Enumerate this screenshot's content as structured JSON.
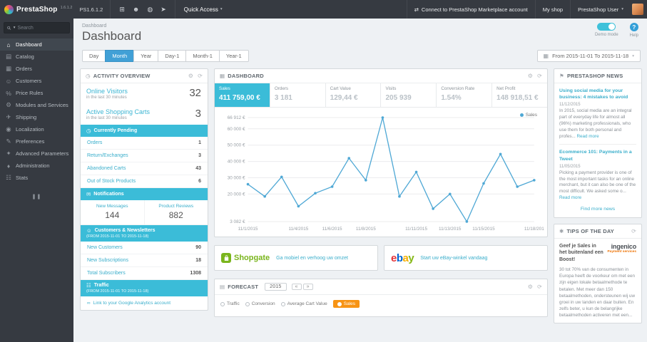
{
  "colors": {
    "topbar_bg": "#363a41",
    "accent_cyan": "#3bbcd8",
    "link_cyan": "#3aaecb",
    "active_button_blue": "#41a0d6",
    "forecast_sales_orange": "#f79415",
    "chart_line_blue": "#4fa8d5",
    "shopgate_green": "#7ab51d"
  },
  "glyphs": {
    "caret_down": "▾",
    "gear": "⚙",
    "refresh": "⟳",
    "calendar": "▦",
    "clock": "◷",
    "envelope": "✉",
    "people": "☺",
    "chart": "☷",
    "flag": "⚑",
    "bulb": "✱",
    "grid": "▦",
    "panel_lines": "▤",
    "link": "∞",
    "arrow_left": "«",
    "arrow_right": "»",
    "pause": "❚❚",
    "cart": "⊞",
    "profile": "☻",
    "lifering": "◍",
    "rocket": "➤",
    "plug": "⇄"
  },
  "topbar": {
    "brand": "PrestaShop",
    "brand_version": "1.6.1.2",
    "shop_version": "PS1.6.1.2",
    "quick_access": "Quick Access",
    "marketplace_link": "Connect to PrestaShop Marketplace account",
    "my_shop": "My shop",
    "user": "PrestaShop User"
  },
  "sidebar": {
    "search_placeholder": "Search",
    "items": [
      {
        "label": "Dashboard",
        "icon": "⌂"
      },
      {
        "label": "Catalog",
        "icon": "▤"
      },
      {
        "label": "Orders",
        "icon": "▦"
      },
      {
        "label": "Customers",
        "icon": "☺"
      },
      {
        "label": "Price Rules",
        "icon": "%"
      },
      {
        "label": "Modules and Services",
        "icon": "⚙"
      },
      {
        "label": "Shipping",
        "icon": "✈"
      },
      {
        "label": "Localization",
        "icon": "◉"
      },
      {
        "label": "Preferences",
        "icon": "✎"
      },
      {
        "label": "Advanced Parameters",
        "icon": "✦"
      },
      {
        "label": "Administration",
        "icon": "♦"
      },
      {
        "label": "Stats",
        "icon": "☷"
      }
    ]
  },
  "header": {
    "breadcrumb": "Dashboard",
    "title": "Dashboard",
    "demo_mode_label": "Demo mode",
    "help_label": "Help",
    "help_q": "?"
  },
  "toolbar": {
    "buttons": [
      "Day",
      "Month",
      "Year",
      "Day-1",
      "Month-1",
      "Year-1"
    ],
    "active": "Month",
    "date_range": "From 2015-11-01 To 2015-11-18"
  },
  "activity": {
    "title": "ACTIVITY OVERVIEW",
    "stats": [
      {
        "label": "Online Visitors",
        "value": "32",
        "sub": "in the last 30 minutes"
      },
      {
        "label": "Active Shopping Carts",
        "value": "3",
        "sub": "in the last 30 minutes"
      }
    ],
    "pending": {
      "title": "Currently Pending",
      "rows": [
        {
          "label": "Orders",
          "value": "1"
        },
        {
          "label": "Return/Exchanges",
          "value": "3"
        },
        {
          "label": "Abandoned Carts",
          "value": "43"
        },
        {
          "label": "Out of Stock Products",
          "value": "6"
        }
      ]
    },
    "notifications": {
      "title": "Notifications",
      "cells": [
        {
          "label": "New Messages",
          "value": "144"
        },
        {
          "label": "Product Reviews",
          "value": "882"
        }
      ]
    },
    "customers": {
      "title": "Customers & Newsletters",
      "subtitle": "(FROM 2015-11-01 TO 2015-11-18)",
      "rows": [
        {
          "label": "New Customers",
          "value": "90"
        },
        {
          "label": "New Subscriptions",
          "value": "18"
        },
        {
          "label": "Total Subscribers",
          "value": "1308"
        }
      ]
    },
    "traffic": {
      "title": "Traffic",
      "subtitle": "(FROM 2015-11-01 TO 2015-11-18)",
      "link": "Link to your Google Analytics account"
    }
  },
  "dashboard": {
    "title": "DASHBOARD",
    "kpis": [
      {
        "label": "Sales",
        "value": "411 759,00 €"
      },
      {
        "label": "Orders",
        "value": "3 181"
      },
      {
        "label": "Cart Value",
        "value": "129,44 €"
      },
      {
        "label": "Visits",
        "value": "205 939"
      },
      {
        "label": "Conversion Rate",
        "value": "1.54%"
      },
      {
        "label": "Net Profit",
        "value": "148 918,51 €"
      }
    ],
    "legend": "Sales"
  },
  "chart_data": {
    "type": "line",
    "title": "Sales",
    "legend_position": "top-right",
    "grid": true,
    "x": [
      "11/1/2015",
      "11/2/2015",
      "11/3/2015",
      "11/4/2015",
      "11/5/2015",
      "11/6/2015",
      "11/7/2015",
      "11/8/2015",
      "11/9/2015",
      "11/10/2015",
      "11/11/2015",
      "11/12/2015",
      "11/13/2015",
      "11/14/2015",
      "11/15/2015",
      "11/16/2015",
      "11/17/2015",
      "11/18/2015"
    ],
    "values": [
      26000,
      18500,
      30500,
      12500,
      20500,
      24500,
      42000,
      28500,
      66912,
      18500,
      33500,
      11000,
      20000,
      3082,
      26500,
      44500,
      24500,
      28500
    ],
    "ylim": [
      3082,
      66912
    ],
    "y_ticks": [
      {
        "label": "66 912 €",
        "value": 66912
      },
      {
        "label": "60 000 €",
        "value": 60000
      },
      {
        "label": "50 000 €",
        "value": 50000
      },
      {
        "label": "40 000 €",
        "value": 40000
      },
      {
        "label": "30 000 €",
        "value": 30000
      },
      {
        "label": "20 000 €",
        "value": 20000
      },
      {
        "label": "3 082 €",
        "value": 3082
      }
    ],
    "x_ticks": [
      {
        "label": "11/1/2015",
        "i": 0
      },
      {
        "label": "11/4/2015",
        "i": 3
      },
      {
        "label": "11/6/2015",
        "i": 5
      },
      {
        "label": "11/8/2015",
        "i": 7
      },
      {
        "label": "11/11/2015",
        "i": 10
      },
      {
        "label": "11/13/2015",
        "i": 12
      },
      {
        "label": "11/15/2015",
        "i": 14
      },
      {
        "label": "11/18/201",
        "i": 17
      }
    ]
  },
  "promos": {
    "shopgate": {
      "brand": "Shopgate",
      "link": "Ga mobiel en verhoog uw omzet"
    },
    "ebay": {
      "letters": [
        "e",
        "b",
        "a",
        "y"
      ],
      "link": "Start uw eBay-winkel vandaag"
    }
  },
  "forecast": {
    "title": "FORECAST",
    "year": "2015",
    "legend": [
      {
        "label": "Traffic"
      },
      {
        "label": "Conversion"
      },
      {
        "label": "Average Cart Value"
      },
      {
        "label": "Sales"
      }
    ]
  },
  "news": {
    "title": "PRESTASHOP NEWS",
    "articles": [
      {
        "title": "Using social media for your business: 4 mistakes to avoid",
        "date": "11/12/2015",
        "excerpt": "In 2015, social media are an integral part of everyday life for almost all (96%) marketing professionals, who use them for both personal and profes...",
        "read_more": "Read more"
      },
      {
        "title": "Ecommerce 101: Payments in a Tweet",
        "date": "11/05/2015",
        "excerpt": "Picking a payment provider is one of the most important tasks for an online merchant, but it can also be one of the most difficult. We asked some o...",
        "read_more": "Read more"
      }
    ],
    "more_link": "Find more news"
  },
  "tips": {
    "title": "TIPS OF THE DAY",
    "headline": "Geef je Sales in het buitenland een Boost!",
    "brand": "ingenico",
    "brand_sub": "Payment services",
    "body": "30 tot 70% van de consumenten in Europa heeft de voorkeur om met een zijn eigen lokale betaalmethode te betalen. Met meer dan 150 betaalmethoden, ondersteunen wij uw groei in uw landen en daar buiten. En zelfs beter, u kun de belangrijke betaalmethoden activeren met een..."
  }
}
